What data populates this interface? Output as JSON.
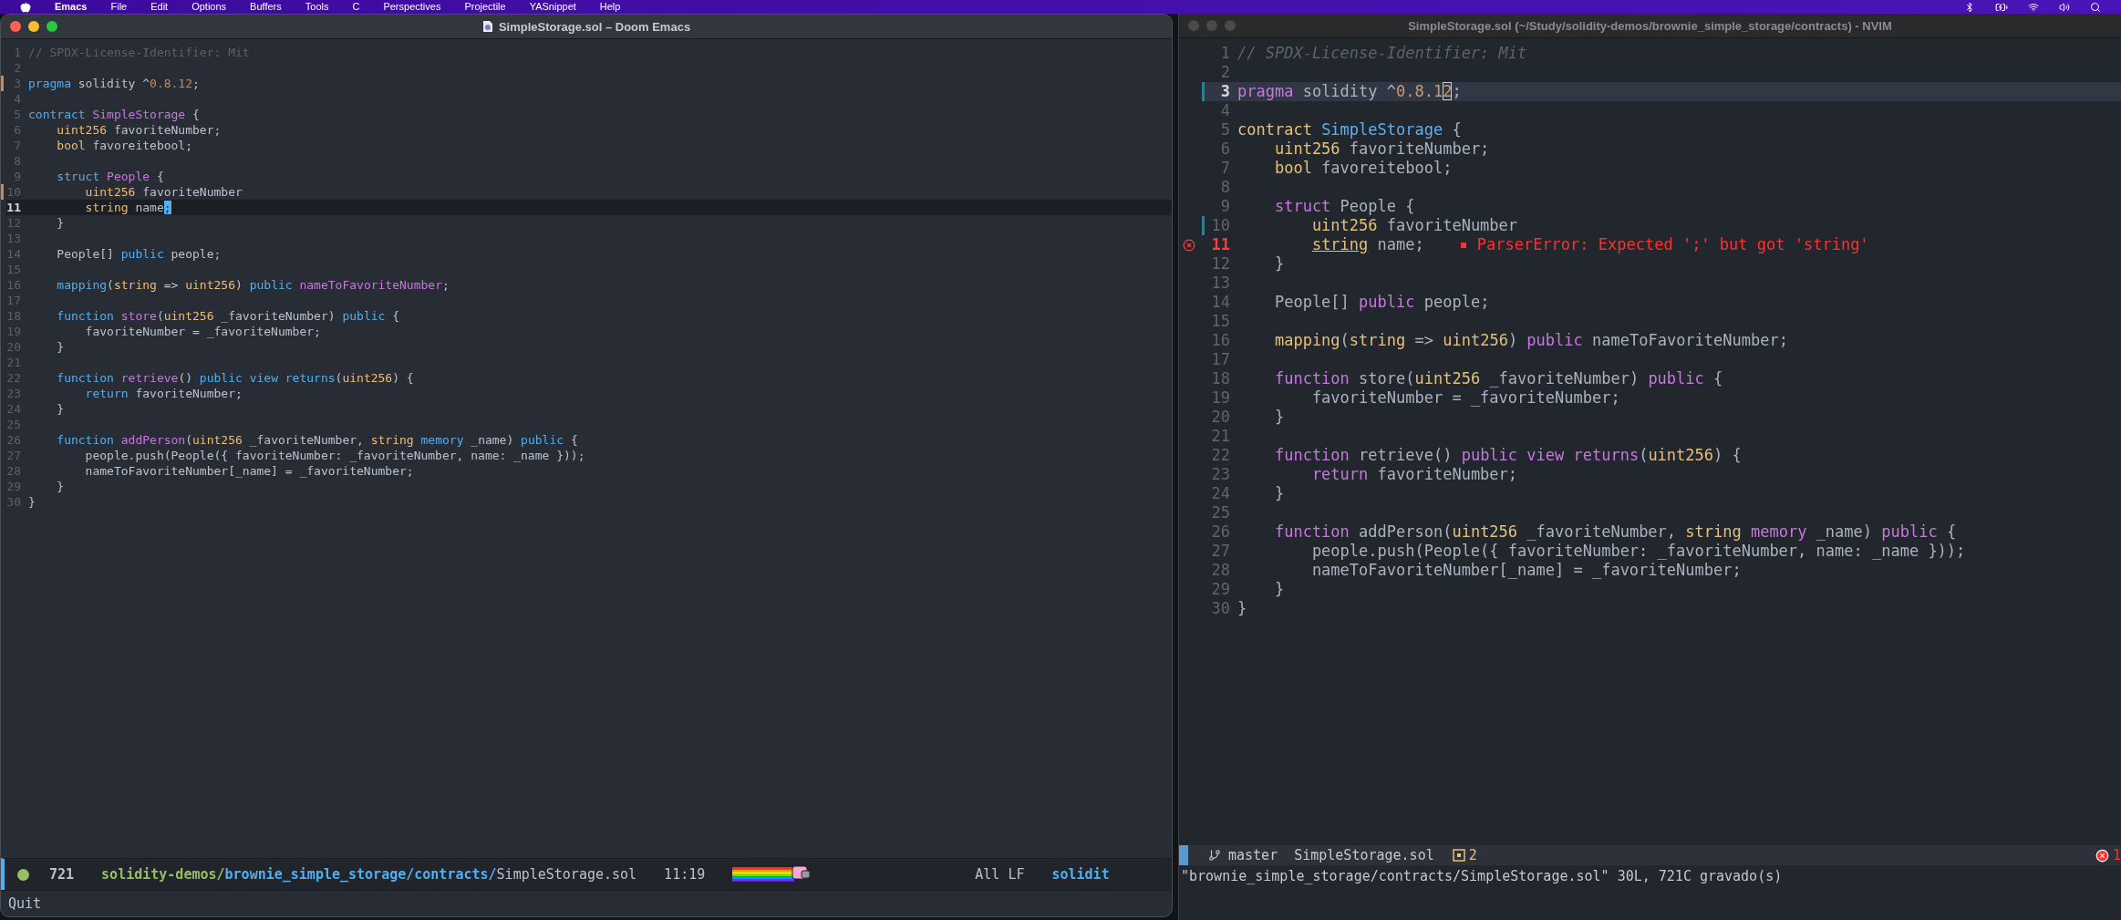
{
  "menu_bar": {
    "items": [
      {
        "label": "Emacs",
        "kind": "app"
      },
      {
        "label": "File",
        "kind": "menu"
      },
      {
        "label": "Edit",
        "kind": "menu"
      },
      {
        "label": "Options",
        "kind": "menu"
      },
      {
        "label": "Buffers",
        "kind": "menu"
      },
      {
        "label": "Tools",
        "kind": "menu"
      },
      {
        "label": "C",
        "kind": "menu"
      },
      {
        "label": "Perspectives",
        "kind": "menu"
      },
      {
        "label": "Projectile",
        "kind": "menu"
      },
      {
        "label": "YASnippet",
        "kind": "menu"
      },
      {
        "label": "Help",
        "kind": "menu"
      }
    ]
  },
  "emacs": {
    "title": "SimpleStorage.sol – Doom Emacs",
    "lines": [
      {
        "n": "1",
        "kind": "plain",
        "current": false,
        "tokens": [
          {
            "text": "// SPDX-License-Identifier: Mit",
            "kind": "comment"
          }
        ]
      },
      {
        "n": "2",
        "kind": "plain",
        "current": false
      },
      {
        "n": "3",
        "kind": "modified",
        "current": false,
        "tokens": [
          {
            "text": "pragma",
            "kind": "keyword"
          },
          {
            "text": " solidity ^",
            "kind": "plain"
          },
          {
            "text": "0.8.12",
            "kind": "number"
          },
          {
            "text": ";",
            "kind": "plain"
          }
        ]
      },
      {
        "n": "4",
        "kind": "plain",
        "current": false
      },
      {
        "n": "5",
        "kind": "plain",
        "current": false,
        "tokens": [
          {
            "text": "contract",
            "kind": "keyword"
          },
          {
            "text": " SimpleStorage",
            "kind": "name"
          },
          {
            "text": " {",
            "kind": "plain"
          }
        ]
      },
      {
        "n": "6",
        "kind": "plain",
        "current": false,
        "tokens": [
          {
            "text": "    uint256",
            "kind": "type"
          },
          {
            "text": " favoriteNumber;",
            "kind": "plain"
          }
        ]
      },
      {
        "n": "7",
        "kind": "plain",
        "current": false,
        "tokens": [
          {
            "text": "    bool",
            "kind": "type"
          },
          {
            "text": " favoreitebool;",
            "kind": "plain"
          }
        ]
      },
      {
        "n": "8",
        "kind": "plain",
        "current": false
      },
      {
        "n": "9",
        "kind": "plain",
        "current": false,
        "tokens": [
          {
            "text": "    struct",
            "kind": "keyword"
          },
          {
            "text": " People",
            "kind": "name"
          },
          {
            "text": " {",
            "kind": "plain"
          }
        ]
      },
      {
        "n": "10",
        "kind": "modified",
        "current": false,
        "tokens": [
          {
            "text": "        uint256",
            "kind": "type"
          },
          {
            "text": " favoriteNumber",
            "kind": "plain"
          }
        ]
      },
      {
        "n": "11",
        "kind": "plain",
        "current": true,
        "tokens": [
          {
            "text": "        string",
            "kind": "type"
          },
          {
            "text": " name",
            "kind": "plain"
          },
          {
            "text": ";",
            "kind": "cursor"
          }
        ]
      },
      {
        "n": "12",
        "kind": "plain",
        "current": false,
        "tokens": [
          {
            "text": "    }",
            "kind": "plain"
          }
        ]
      },
      {
        "n": "13",
        "kind": "plain",
        "current": false
      },
      {
        "n": "14",
        "kind": "plain",
        "current": false,
        "tokens": [
          {
            "text": "    People[] ",
            "kind": "plain"
          },
          {
            "text": "public",
            "kind": "keyword"
          },
          {
            "text": " people;",
            "kind": "plain"
          }
        ]
      },
      {
        "n": "15",
        "kind": "plain",
        "current": false
      },
      {
        "n": "16",
        "kind": "plain",
        "current": false,
        "tokens": [
          {
            "text": "    mapping",
            "kind": "keyword"
          },
          {
            "text": "(",
            "kind": "plain"
          },
          {
            "text": "string",
            "kind": "type"
          },
          {
            "text": " => ",
            "kind": "plain"
          },
          {
            "text": "uint256",
            "kind": "type"
          },
          {
            "text": ") ",
            "kind": "plain"
          },
          {
            "text": "public",
            "kind": "keyword"
          },
          {
            "text": " nameToFavoriteNumber",
            "kind": "name"
          },
          {
            "text": ";",
            "kind": "plain"
          }
        ]
      },
      {
        "n": "17",
        "kind": "plain",
        "current": false
      },
      {
        "n": "18",
        "kind": "plain",
        "current": false,
        "tokens": [
          {
            "text": "    function",
            "kind": "keyword"
          },
          {
            "text": " store",
            "kind": "name"
          },
          {
            "text": "(",
            "kind": "plain"
          },
          {
            "text": "uint256",
            "kind": "type"
          },
          {
            "text": " _favoriteNumber) ",
            "kind": "plain"
          },
          {
            "text": "public",
            "kind": "keyword"
          },
          {
            "text": " {",
            "kind": "plain"
          }
        ]
      },
      {
        "n": "19",
        "kind": "plain",
        "current": false,
        "tokens": [
          {
            "text": "        favoriteNumber = _favoriteNumber;",
            "kind": "plain"
          }
        ]
      },
      {
        "n": "20",
        "kind": "plain",
        "current": false,
        "tokens": [
          {
            "text": "    }",
            "kind": "plain"
          }
        ]
      },
      {
        "n": "21",
        "kind": "plain",
        "current": false
      },
      {
        "n": "22",
        "kind": "plain",
        "current": false,
        "tokens": [
          {
            "text": "    function",
            "kind": "keyword"
          },
          {
            "text": " retrieve",
            "kind": "name"
          },
          {
            "text": "() ",
            "kind": "plain"
          },
          {
            "text": "public view returns",
            "kind": "keyword"
          },
          {
            "text": "(",
            "kind": "plain"
          },
          {
            "text": "uint256",
            "kind": "type"
          },
          {
            "text": ") {",
            "kind": "plain"
          }
        ]
      },
      {
        "n": "23",
        "kind": "plain",
        "current": false,
        "tokens": [
          {
            "text": "        return",
            "kind": "keyword"
          },
          {
            "text": " favoriteNumber;",
            "kind": "plain"
          }
        ]
      },
      {
        "n": "24",
        "kind": "plain",
        "current": false,
        "tokens": [
          {
            "text": "    }",
            "kind": "plain"
          }
        ]
      },
      {
        "n": "25",
        "kind": "plain",
        "current": false
      },
      {
        "n": "26",
        "kind": "plain",
        "current": false,
        "tokens": [
          {
            "text": "    function",
            "kind": "keyword"
          },
          {
            "text": " addPerson",
            "kind": "name"
          },
          {
            "text": "(",
            "kind": "plain"
          },
          {
            "text": "uint256",
            "kind": "type"
          },
          {
            "text": " _favoriteNumber, ",
            "kind": "plain"
          },
          {
            "text": "string",
            "kind": "type"
          },
          {
            "text": " memory",
            "kind": "keyword"
          },
          {
            "text": " _name) ",
            "kind": "plain"
          },
          {
            "text": "public",
            "kind": "keyword"
          },
          {
            "text": " {",
            "kind": "plain"
          }
        ]
      },
      {
        "n": "27",
        "kind": "plain",
        "current": false,
        "tokens": [
          {
            "text": "        people.push(People({ favoriteNumber: _favoriteNumber, name: _name }));",
            "kind": "plain"
          }
        ]
      },
      {
        "n": "28",
        "kind": "plain",
        "current": false,
        "tokens": [
          {
            "text": "        nameToFavoriteNumber[_name] = _favoriteNumber;",
            "kind": "plain"
          }
        ]
      },
      {
        "n": "29",
        "kind": "plain",
        "current": false,
        "tokens": [
          {
            "text": "    }",
            "kind": "plain"
          }
        ]
      },
      {
        "n": "30",
        "kind": "plain",
        "current": false,
        "tokens": [
          {
            "text": "}",
            "kind": "plain"
          }
        ]
      }
    ],
    "modeline": {
      "buffer_size": "721",
      "path": [
        {
          "text": "solidity-demos/",
          "kind": "project"
        },
        {
          "text": "brownie_simple_storage/contracts/",
          "kind": "dir"
        },
        {
          "text": "SimpleStorage.sol",
          "kind": "file"
        }
      ],
      "position": "11:19",
      "eol": "All LF",
      "workspace": "solidit"
    },
    "minibuffer": "Quit"
  },
  "nvim": {
    "title": "SimpleStorage.sol (~/Study/solidity-demos/brownie_simple_storage/contracts) - NVIM",
    "lines": [
      {
        "n": "1",
        "kind": "plain",
        "current": false,
        "tokens": [
          {
            "text": "// SPDX-License-Identifier: Mit",
            "kind": "comment"
          }
        ]
      },
      {
        "n": "2",
        "kind": "plain",
        "current": false
      },
      {
        "n": "3",
        "kind": "modified",
        "current": true,
        "tokens": [
          {
            "text": "pragma",
            "kind": "keyword"
          },
          {
            "text": " solidity ^",
            "kind": "plain"
          },
          {
            "text": "0.8.1",
            "kind": "number"
          },
          {
            "text": "2",
            "kind": "cursor"
          },
          {
            "text": ";",
            "kind": "plain"
          }
        ]
      },
      {
        "n": "4",
        "kind": "plain",
        "current": false
      },
      {
        "n": "5",
        "kind": "plain",
        "current": false,
        "tokens": [
          {
            "text": "contract",
            "kind": "type"
          },
          {
            "text": " SimpleStorage",
            "kind": "name"
          },
          {
            "text": " {",
            "kind": "plain"
          }
        ]
      },
      {
        "n": "6",
        "kind": "plain",
        "current": false,
        "tokens": [
          {
            "text": "    uint256",
            "kind": "type"
          },
          {
            "text": " favoriteNumber;",
            "kind": "plain"
          }
        ]
      },
      {
        "n": "7",
        "kind": "plain",
        "current": false,
        "tokens": [
          {
            "text": "    bool",
            "kind": "type"
          },
          {
            "text": " favoreitebool;",
            "kind": "plain"
          }
        ]
      },
      {
        "n": "8",
        "kind": "plain",
        "current": false
      },
      {
        "n": "9",
        "kind": "plain",
        "current": false,
        "tokens": [
          {
            "text": "    struct",
            "kind": "keyword"
          },
          {
            "text": " People {",
            "kind": "plain"
          }
        ]
      },
      {
        "n": "10",
        "kind": "modified",
        "current": false,
        "tokens": [
          {
            "text": "        uint256",
            "kind": "type"
          },
          {
            "text": " favoriteNumber",
            "kind": "plain"
          }
        ]
      },
      {
        "n": "11",
        "kind": "error",
        "current": false,
        "diagnostic": "ParserError: Expected ';' but got 'string'",
        "tokens": [
          {
            "text": "        string",
            "kind": "error"
          },
          {
            "text": " name;",
            "kind": "plain"
          }
        ]
      },
      {
        "n": "12",
        "kind": "plain",
        "current": false,
        "tokens": [
          {
            "text": "    }",
            "kind": "plain"
          }
        ]
      },
      {
        "n": "13",
        "kind": "plain",
        "current": false
      },
      {
        "n": "14",
        "kind": "plain",
        "current": false,
        "tokens": [
          {
            "text": "    People[] ",
            "kind": "plain"
          },
          {
            "text": "public",
            "kind": "keyword"
          },
          {
            "text": " people;",
            "kind": "plain"
          }
        ]
      },
      {
        "n": "15",
        "kind": "plain",
        "current": false
      },
      {
        "n": "16",
        "kind": "plain",
        "current": false,
        "tokens": [
          {
            "text": "    mapping",
            "kind": "type"
          },
          {
            "text": "(",
            "kind": "plain"
          },
          {
            "text": "string",
            "kind": "type"
          },
          {
            "text": " => ",
            "kind": "plain"
          },
          {
            "text": "uint256",
            "kind": "type"
          },
          {
            "text": ") ",
            "kind": "plain"
          },
          {
            "text": "public",
            "kind": "keyword"
          },
          {
            "text": " nameToFavoriteNumber;",
            "kind": "plain"
          }
        ]
      },
      {
        "n": "17",
        "kind": "plain",
        "current": false
      },
      {
        "n": "18",
        "kind": "plain",
        "current": false,
        "tokens": [
          {
            "text": "    function",
            "kind": "keyword"
          },
          {
            "text": " store(",
            "kind": "plain"
          },
          {
            "text": "uint256",
            "kind": "type"
          },
          {
            "text": " _favoriteNumber) ",
            "kind": "plain"
          },
          {
            "text": "public",
            "kind": "keyword"
          },
          {
            "text": " {",
            "kind": "plain"
          }
        ]
      },
      {
        "n": "19",
        "kind": "plain",
        "current": false,
        "tokens": [
          {
            "text": "        favoriteNumber = _favoriteNumber;",
            "kind": "plain"
          }
        ]
      },
      {
        "n": "20",
        "kind": "plain",
        "current": false,
        "tokens": [
          {
            "text": "    }",
            "kind": "plain"
          }
        ]
      },
      {
        "n": "21",
        "kind": "plain",
        "current": false
      },
      {
        "n": "22",
        "kind": "plain",
        "current": false,
        "tokens": [
          {
            "text": "    function",
            "kind": "keyword"
          },
          {
            "text": " retrieve() ",
            "kind": "plain"
          },
          {
            "text": "public view returns",
            "kind": "keyword"
          },
          {
            "text": "(",
            "kind": "plain"
          },
          {
            "text": "uint256",
            "kind": "type"
          },
          {
            "text": ") {",
            "kind": "plain"
          }
        ]
      },
      {
        "n": "23",
        "kind": "plain",
        "current": false,
        "tokens": [
          {
            "text": "        return",
            "kind": "keyword"
          },
          {
            "text": " favoriteNumber;",
            "kind": "plain"
          }
        ]
      },
      {
        "n": "24",
        "kind": "plain",
        "current": false,
        "tokens": [
          {
            "text": "    }",
            "kind": "plain"
          }
        ]
      },
      {
        "n": "25",
        "kind": "plain",
        "current": false
      },
      {
        "n": "26",
        "kind": "plain",
        "current": false,
        "tokens": [
          {
            "text": "    function",
            "kind": "keyword"
          },
          {
            "text": " addPerson(",
            "kind": "plain"
          },
          {
            "text": "uint256",
            "kind": "type"
          },
          {
            "text": " _favoriteNumber, ",
            "kind": "plain"
          },
          {
            "text": "string",
            "kind": "type"
          },
          {
            "text": " memory",
            "kind": "keyword"
          },
          {
            "text": " _name) ",
            "kind": "plain"
          },
          {
            "text": "public",
            "kind": "keyword"
          },
          {
            "text": " {",
            "kind": "plain"
          }
        ]
      },
      {
        "n": "27",
        "kind": "plain",
        "current": false,
        "tokens": [
          {
            "text": "        people.push(People({ favoriteNumber: _favoriteNumber, name: _name }));",
            "kind": "plain"
          }
        ]
      },
      {
        "n": "28",
        "kind": "plain",
        "current": false,
        "tokens": [
          {
            "text": "        nameToFavoriteNumber[_name] = _favoriteNumber;",
            "kind": "plain"
          }
        ]
      },
      {
        "n": "29",
        "kind": "plain",
        "current": false,
        "tokens": [
          {
            "text": "    }",
            "kind": "plain"
          }
        ]
      },
      {
        "n": "30",
        "kind": "plain",
        "current": false,
        "tokens": [
          {
            "text": "}",
            "kind": "plain"
          }
        ]
      }
    ],
    "statusline": {
      "branch": "master",
      "file": "SimpleStorage.sol",
      "warnings": "2",
      "errors": "1"
    },
    "message": "\"brownie_simple_storage/contracts/SimpleStorage.sol\" 30L, 721C gravado(s)"
  }
}
